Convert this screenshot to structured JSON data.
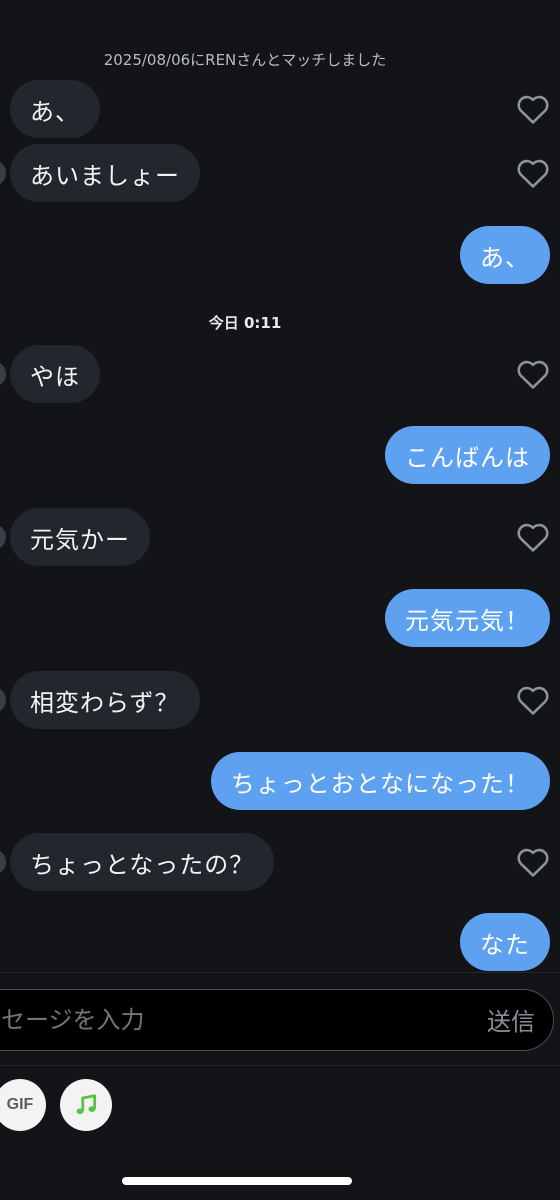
{
  "chat": {
    "match_notice": "2025/08/06にRENさんとマッチしました",
    "date_separator": "今日 0:11",
    "messages": [
      {
        "text": "あ、",
        "direction": "in"
      },
      {
        "text": "あいましょー",
        "direction": "in"
      },
      {
        "text": "あ、",
        "direction": "out"
      },
      {
        "text": "やほ",
        "direction": "in"
      },
      {
        "text": "こんばんは",
        "direction": "out"
      },
      {
        "text": "元気かー",
        "direction": "in"
      },
      {
        "text": "元気元気！",
        "direction": "out"
      },
      {
        "text": "相変わらず？",
        "direction": "in"
      },
      {
        "text": "ちょっとおとなになった！",
        "direction": "out"
      },
      {
        "text": "ちょっとなったの？",
        "direction": "in"
      },
      {
        "text": "なた",
        "direction": "out"
      }
    ],
    "like_icon": "heart-outline-icon"
  },
  "composer": {
    "placeholder": "セージを入力",
    "send_label": "送信",
    "gif_label": "GIF",
    "music_icon": "music-note-icon"
  },
  "colors": {
    "background": "#121417",
    "incoming_bubble": "#22262d",
    "outgoing_bubble": "#5ea1f0",
    "music_green": "#58c24a"
  }
}
